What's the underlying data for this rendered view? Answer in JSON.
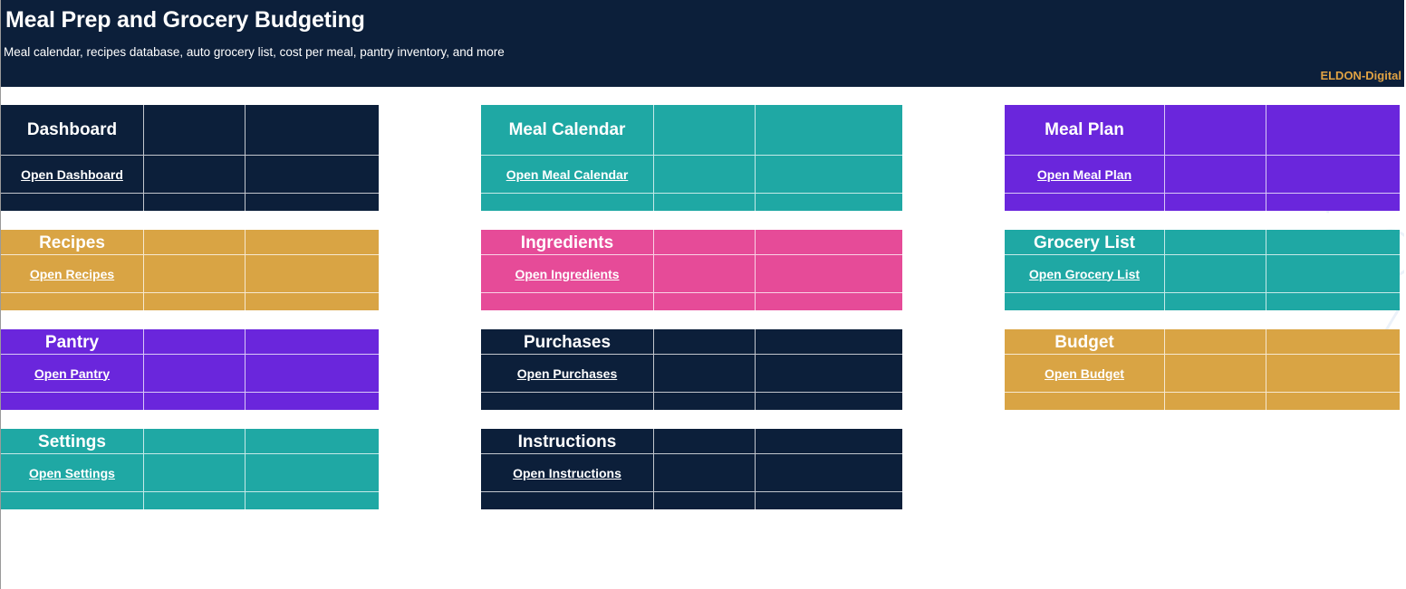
{
  "header": {
    "title": "Meal Prep and Grocery Budgeting",
    "subtitle": "Meal calendar, recipes database, auto grocery list, cost per meal, pantry inventory, and more",
    "brand": "ELDON-Digital"
  },
  "colors": {
    "navy": "#0c1f3a",
    "teal": "#1fa8a4",
    "purple": "#6a26dc",
    "gold": "#d9a444",
    "pink": "#e64b98",
    "brand_text": "#e0a243"
  },
  "cards": {
    "dashboard": {
      "title": "Dashboard",
      "link": "Open Dashboard"
    },
    "meal_calendar": {
      "title": "Meal Calendar",
      "link": "Open Meal Calendar"
    },
    "meal_plan": {
      "title": "Meal Plan",
      "link": "Open Meal Plan"
    },
    "recipes": {
      "title": "Recipes",
      "link": "Open Recipes"
    },
    "ingredients": {
      "title": "Ingredients",
      "link": "Open Ingredients"
    },
    "grocery_list": {
      "title": "Grocery List",
      "link": "Open Grocery List"
    },
    "pantry": {
      "title": "Pantry",
      "link": "Open Pantry"
    },
    "purchases": {
      "title": "Purchases",
      "link": "Open Purchases"
    },
    "budget": {
      "title": "Budget",
      "link": "Open Budget"
    },
    "settings": {
      "title": "Settings",
      "link": "Open Settings"
    },
    "instructions": {
      "title": "Instructions",
      "link": "Open Instructions"
    }
  }
}
